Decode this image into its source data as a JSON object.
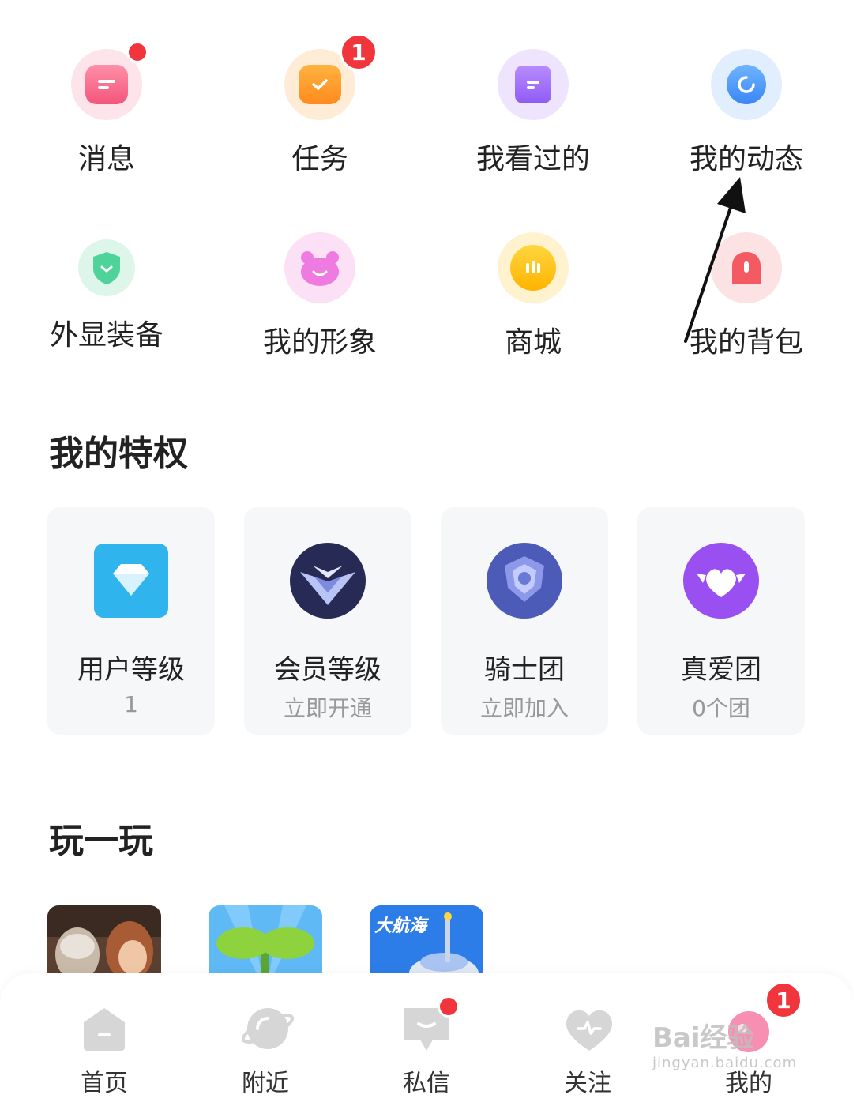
{
  "grid": [
    {
      "label": "消息",
      "icon": "message-icon",
      "indicator": "dot",
      "badge": ""
    },
    {
      "label": "任务",
      "icon": "task-icon",
      "indicator": "badge",
      "badge": "1"
    },
    {
      "label": "我看过的",
      "icon": "history-icon",
      "indicator": "none",
      "badge": ""
    },
    {
      "label": "我的动态",
      "icon": "moments-icon",
      "indicator": "none",
      "badge": ""
    },
    {
      "label": "外显装备",
      "icon": "shield-icon",
      "indicator": "none",
      "badge": ""
    },
    {
      "label": "我的形象",
      "icon": "avatar-bear-icon",
      "indicator": "none",
      "badge": ""
    },
    {
      "label": "商城",
      "icon": "shop-icon",
      "indicator": "none",
      "badge": ""
    },
    {
      "label": "我的背包",
      "icon": "backpack-icon",
      "indicator": "none",
      "badge": ""
    }
  ],
  "privileges": {
    "title": "我的特权",
    "cards": [
      {
        "title": "用户等级",
        "sub": "1",
        "icon": "diamond-icon"
      },
      {
        "title": "会员等级",
        "sub": "立即开通",
        "icon": "vip-wings-icon"
      },
      {
        "title": "骑士团",
        "sub": "立即加入",
        "icon": "knight-shield-icon"
      },
      {
        "title": "真爱团",
        "sub": "0个团",
        "icon": "heart-wings-icon"
      }
    ]
  },
  "play": {
    "title": "玩一玩",
    "games": [
      {
        "icon": "game-characters-thumbnail",
        "label": ""
      },
      {
        "icon": "game-sprout-thumbnail",
        "label": ""
      },
      {
        "icon": "game-voyage-thumbnail",
        "label": "大航海"
      }
    ]
  },
  "tabbar": {
    "tabs": [
      {
        "label": "首页",
        "icon": "home-icon"
      },
      {
        "label": "附近",
        "icon": "planet-icon"
      },
      {
        "label": "私信",
        "icon": "chat-icon"
      },
      {
        "label": "关注",
        "icon": "heart-pulse-icon"
      },
      {
        "label": "我的",
        "icon": "profile-icon"
      }
    ],
    "chat_dot": true,
    "profile_badge": "1"
  },
  "watermark": {
    "main": "Bai经验",
    "sub": "jingyan.baidu.com"
  },
  "colors": {
    "badge": "#f0353d",
    "card_bg": "#f6f7f9",
    "subtext": "#999999"
  }
}
